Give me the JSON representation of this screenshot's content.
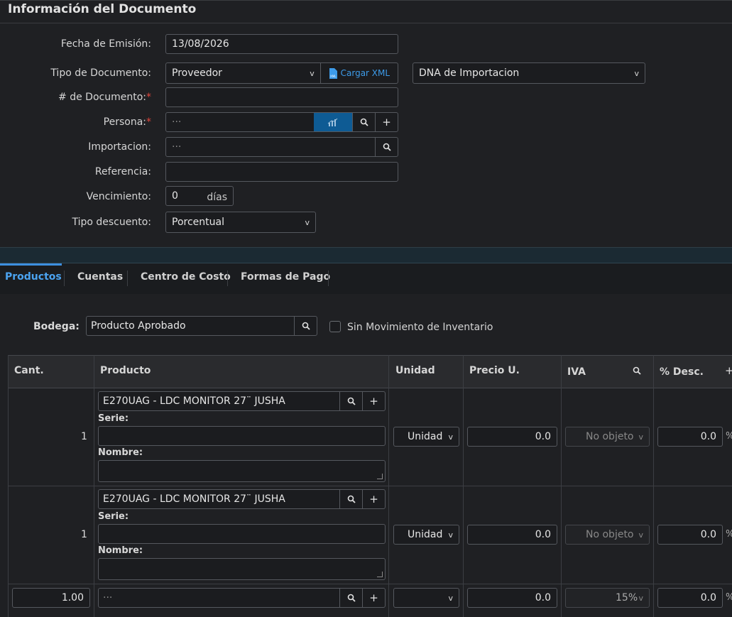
{
  "header": {
    "title": "Información del Documento"
  },
  "form": {
    "fecha_label": "Fecha de Emisión:",
    "fecha_value": "13/08/2026",
    "tipo_doc_label": "Tipo de Documento:",
    "tipo_doc_value": "Proveedor",
    "cargar_xml_label": "Cargar XML",
    "dna_value": "DNA de Importacion",
    "num_doc_label": "# de Documento:",
    "persona_label": "Persona:",
    "persona_placeholder": "···",
    "importacion_label": "Importacion:",
    "importacion_placeholder": "···",
    "referencia_label": "Referencia:",
    "vencimiento_label": "Vencimiento:",
    "vencimiento_value": "0",
    "vencimiento_unit": "días",
    "tipo_descuento_label": "Tipo descuento:",
    "tipo_descuento_value": "Porcentual",
    "required_mark": "*"
  },
  "tabs": [
    {
      "label": "Productos"
    },
    {
      "label": "Cuentas"
    },
    {
      "label": "Centro de Costo"
    },
    {
      "label": "Formas de Pago"
    }
  ],
  "bodega": {
    "label": "Bodega:",
    "value": "Producto Aprobado",
    "sin_mov_label": "Sin Movimiento de Inventario"
  },
  "table": {
    "headers": {
      "cant": "Cant.",
      "producto": "Producto",
      "unidad": "Unidad",
      "precio": "Precio U.",
      "iva": "IVA",
      "desc": "% Desc."
    },
    "serie_label": "Serie:",
    "nombre_label": "Nombre:",
    "rows": [
      {
        "cant": "1",
        "producto": "E270UAG - LDC MONITOR 27¨ JUSHA",
        "unidad": "Unidad",
        "precio": "0.0",
        "iva": "No objeto",
        "desc": "0.0",
        "pct": "%"
      },
      {
        "cant": "1",
        "producto": "E270UAG - LDC MONITOR 27¨ JUSHA",
        "unidad": "Unidad",
        "precio": "0.0",
        "iva": "No objeto",
        "desc": "0.0",
        "pct": "%"
      }
    ],
    "new_row": {
      "cant": "1.00",
      "producto_placeholder": "···",
      "unidad": "",
      "precio": "0.0",
      "iva": "15%",
      "desc": "0.0",
      "pct": "%"
    }
  }
}
